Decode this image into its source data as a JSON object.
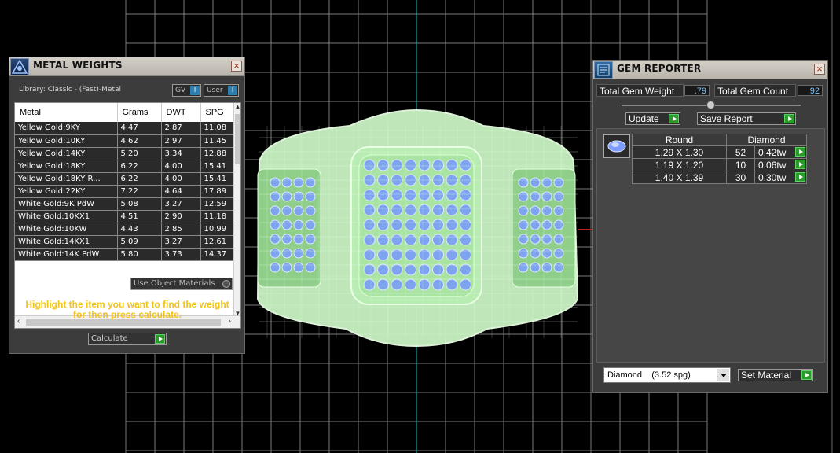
{
  "metal_weights": {
    "title": "METAL WEIGHTS",
    "library_label": "Library: Classic - (Fast)-Metal",
    "toggle_gv": "GV",
    "toggle_user": "User",
    "columns": [
      "Metal",
      "Grams",
      "DWT",
      "SPG"
    ],
    "rows": [
      [
        "Yellow Gold:9KY",
        "4.47",
        "2.87",
        "11.08"
      ],
      [
        "Yellow Gold:10KY",
        "4.62",
        "2.97",
        "11.45"
      ],
      [
        "Yellow Gold:14KY",
        "5.20",
        "3.34",
        "12.88"
      ],
      [
        "Yellow Gold:18KY",
        "6.22",
        "4.00",
        "15.41"
      ],
      [
        "Yellow Gold:18KY R...",
        "6.22",
        "4.00",
        "15.41"
      ],
      [
        "Yellow Gold:22KY",
        "7.22",
        "4.64",
        "17.89"
      ],
      [
        "White Gold:9K PdW",
        "5.08",
        "3.27",
        "12.59"
      ],
      [
        "White Gold:10KX1",
        "4.51",
        "2.90",
        "11.18"
      ],
      [
        "White Gold:10KW",
        "4.43",
        "2.85",
        "10.99"
      ],
      [
        "White Gold:14KX1",
        "5.09",
        "3.27",
        "12.61"
      ],
      [
        "White Gold:14K PdW",
        "5.80",
        "3.73",
        "14.37"
      ]
    ],
    "use_object_materials": "Use Object Materials",
    "hint_line1": "Highlight the item you want to find the weight",
    "hint_line2": "for then press calculate.",
    "calculate_label": "Calculate",
    "close_glyph": "×"
  },
  "gem_reporter": {
    "title": "GEM REPORTER",
    "total_weight_label": "Total Gem Weight",
    "total_weight_value": ".79",
    "total_count_label": "Total Gem Count",
    "total_count_value": "92",
    "update_label": "Update",
    "save_report_label": "Save Report",
    "table_headers": [
      "Round",
      "Diamond"
    ],
    "gem_rows": [
      {
        "size": "1.29 X 1.30",
        "count": "52",
        "tw": "0.42tw"
      },
      {
        "size": "1.19 X 1.20",
        "count": "10",
        "tw": "0.06tw"
      },
      {
        "size": "1.40 X 1.39",
        "count": "30",
        "tw": "0.30tw"
      }
    ],
    "material_selected": "Diamond    (3.52 spg)",
    "set_material_label": "Set Material",
    "close_glyph": "×"
  },
  "colors": {
    "ring_fill": "#c9f3c3",
    "ring_line": "#e9ffe4",
    "gem_blue": "#7ea4ef",
    "grid_line": "#7a7a7a",
    "axis_cyan": "#1fb6c9",
    "hint_text": "#f3c317"
  }
}
